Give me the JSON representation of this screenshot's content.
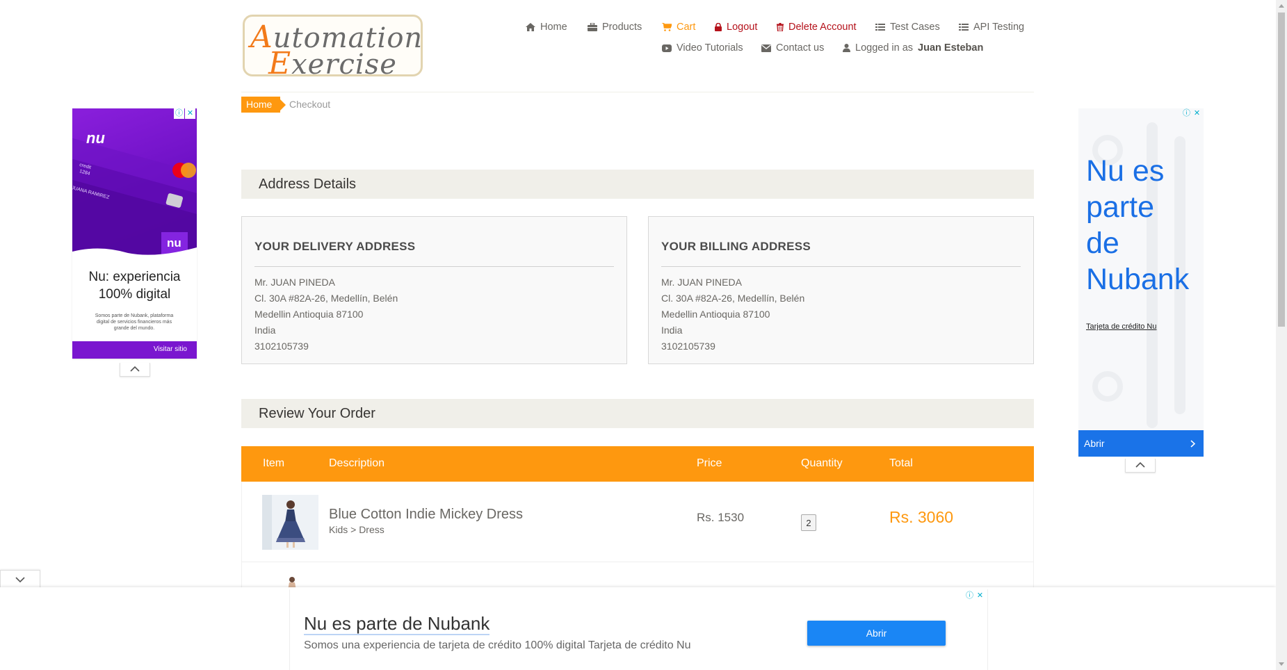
{
  "logo": {
    "line1_cap": "A",
    "line1_rest": "utomation",
    "line2_cap": "E",
    "line2_rest": "xercise"
  },
  "nav": {
    "home": "Home",
    "products": "Products",
    "cart": "Cart",
    "logout": "Logout",
    "delete_account": "Delete Account",
    "test_cases": "Test Cases",
    "api_testing": "API Testing",
    "video_tutorials": "Video Tutorials",
    "contact_us": "Contact us",
    "logged_in_prefix": "Logged in as",
    "logged_in_user": "Juan Esteban"
  },
  "breadcrumb": {
    "home": "Home",
    "current": "Checkout"
  },
  "address_section": {
    "title": "Address Details"
  },
  "delivery": {
    "title": "YOUR DELIVERY ADDRESS",
    "name": "Mr. JUAN PINEDA",
    "street": "Cl. 30A #82A-26, Medellín, Belén",
    "city": "Medellin Antioquia 87100",
    "country": "India",
    "phone": "3102105739"
  },
  "billing": {
    "title": "YOUR BILLING ADDRESS",
    "name": "Mr. JUAN PINEDA",
    "street": "Cl. 30A #82A-26, Medellín, Belén",
    "city": "Medellin Antioquia 87100",
    "country": "India",
    "phone": "3102105739"
  },
  "review_section": {
    "title": "Review Your Order"
  },
  "order_table": {
    "headers": [
      "Item",
      "Description",
      "Price",
      "Quantity",
      "Total"
    ],
    "rows": [
      {
        "name": "Blue Cotton Indie Mickey Dress",
        "category": "Kids > Dress",
        "price": "Rs. 1530",
        "quantity": "2",
        "total": "Rs. 3060"
      }
    ]
  },
  "ad_left": {
    "brand": "nu",
    "card_text": "credit",
    "card_number": "1284",
    "card_holder": "JUANA RAMIREZ",
    "headline_1": "Nu: experiencia",
    "headline_2": "100% digital",
    "small_text": "Somos parte de Nubank, plataforma digital de servicios financieros más grande del mundo.",
    "cta": "Visitar sitio",
    "info": "ⓘ",
    "close": "✕"
  },
  "ad_right": {
    "headline": [
      "Nu es",
      "parte",
      "de",
      "Nubank"
    ],
    "link": "Tarjeta de crédito Nu",
    "cta": "Abrir",
    "info": "ⓘ",
    "close": "✕"
  },
  "ad_bottom": {
    "title": "Nu es parte de Nubank",
    "description": "Somos una experiencia de tarjeta de crédito 100% digital Tarjeta de crédito Nu",
    "cta": "Abrir",
    "info": "ⓘ",
    "close": "✕"
  },
  "colors": {
    "accent": "#fe980f",
    "danger": "#b5121b",
    "section_bg": "#f0efe9",
    "ad_purple": "#8a1fdc",
    "ad_blue": "#1a73e8"
  },
  "icons": {
    "home": "home-icon",
    "products": "briefcase-icon",
    "cart": "shopping-cart-icon",
    "logout": "lock-icon",
    "delete": "trash-icon",
    "test_cases": "list-icon",
    "api": "list-icon",
    "video": "youtube-play-icon",
    "contact": "envelope-icon",
    "user": "user-icon"
  }
}
